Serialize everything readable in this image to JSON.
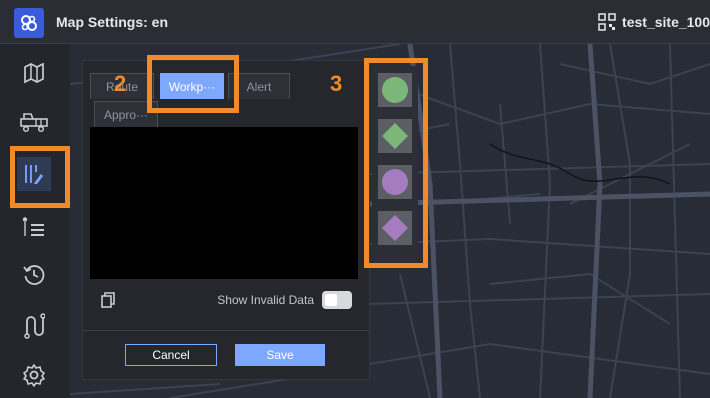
{
  "header": {
    "title": "Map Settings: en",
    "site_name": "test_site_100"
  },
  "sidebar": {
    "items": [
      {
        "name": "map-icon"
      },
      {
        "name": "truck-icon"
      },
      {
        "name": "map-settings-icon"
      },
      {
        "name": "list-icon"
      },
      {
        "name": "history-icon"
      },
      {
        "name": "route-icon"
      },
      {
        "name": "gear-icon"
      }
    ]
  },
  "dialog": {
    "tabs": [
      "Route",
      "Workp···",
      "Alert",
      "Appro···"
    ],
    "active_tab": "Workp···",
    "show_invalid_label": "Show Invalid Data",
    "cancel_label": "Cancel",
    "save_label": "Save"
  },
  "palette": {
    "markers": [
      {
        "shape": "circle",
        "color": "#7cb77a"
      },
      {
        "shape": "diamond",
        "color": "#7cb77a"
      },
      {
        "shape": "circle",
        "color": "#a57cbf"
      },
      {
        "shape": "diamond",
        "color": "#a57cbf"
      }
    ]
  },
  "annotations": {
    "step2": "2",
    "step3": "3"
  },
  "colors": {
    "accent": "#7ea8ff",
    "highlight": "#f08a2a",
    "logo": "#3b5bdb"
  }
}
